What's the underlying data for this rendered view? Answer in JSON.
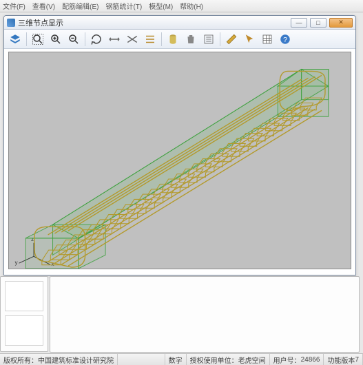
{
  "menu": {
    "items": [
      "文件(F)",
      "查看(V)",
      "配筋编辑(E)",
      "钢筋统计(T)",
      "模型(M)",
      "帮助(H)"
    ]
  },
  "window": {
    "title": "三维节点显示",
    "min": "—",
    "max": "□",
    "close": "✕"
  },
  "toolbar": {
    "layers": "layers-icon",
    "zoom_extents": "zoom-extents-icon",
    "zoom_in": "zoom-in-icon",
    "zoom_out": "zoom-out-icon",
    "rotate": "rotate-icon",
    "dim_h": "dim-horizontal-icon",
    "dim_v": "dim-vertical-icon",
    "lines": "line-style-icon",
    "cylinder": "cylinder-icon",
    "delete": "trash-icon",
    "list": "list-icon",
    "measure": "measure-icon",
    "pointer": "pointer-icon",
    "table": "table-icon",
    "help": "help-icon"
  },
  "view": {
    "axes": {
      "x": "x",
      "y": "y",
      "z": "z"
    }
  },
  "status": {
    "copyright_label": "版权所有：",
    "copyright_owner": "中国建筑标准设计研究院",
    "num": "数字",
    "licensee_label": "授权使用单位：",
    "licensee": "老虎空间",
    "user_label": "用户号：",
    "user_id": "24866",
    "version_label": "功能版本",
    "version": "7"
  }
}
